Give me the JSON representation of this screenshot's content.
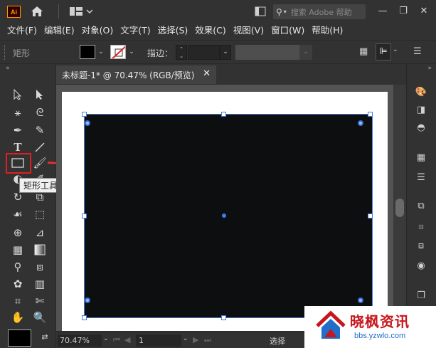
{
  "app": {
    "logo_text": "Ai"
  },
  "search": {
    "placeholder": "搜索 Adobe 帮助"
  },
  "menu": {
    "items": [
      "文件(F)",
      "编辑(E)",
      "对象(O)",
      "文字(T)",
      "选择(S)",
      "效果(C)",
      "视图(V)",
      "窗口(W)",
      "帮助(H)"
    ]
  },
  "control": {
    "shape_label": "矩形",
    "stroke_label": "描边："
  },
  "tooltip": {
    "text": "矩形工具 (M)"
  },
  "document": {
    "tab_title": "未标题-1* @ 70.47% (RGB/预览)"
  },
  "status": {
    "zoom": "70.47%",
    "artboard": "1",
    "tool_name": "选择"
  },
  "watermark": {
    "title": "晓枫资讯",
    "url": "bbs.yzwlo.com"
  },
  "colors": {
    "highlight": "#e02020",
    "selection": "#4a7bd8",
    "fill": "#0c0e0f"
  }
}
